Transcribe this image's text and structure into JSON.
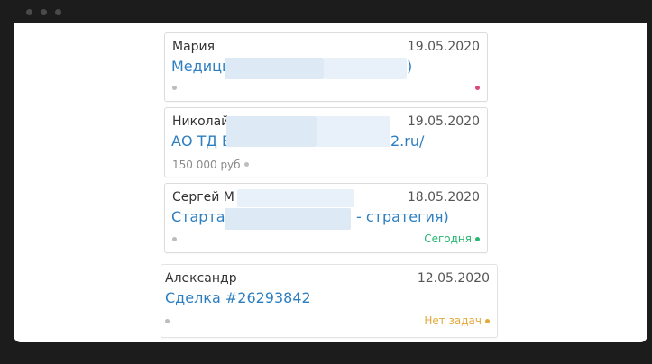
{
  "cards": [
    {
      "name": "Мария",
      "date": "19.05.2020",
      "title_prefix": "Медици",
      "title_suffix": ")",
      "amount": "",
      "status": "",
      "status_color": "#e0457b"
    },
    {
      "name": "Николай",
      "date": "19.05.2020",
      "title_prefix": "АО ТД В",
      "title_suffix": "2.ru/",
      "amount": "150 000 руб",
      "status": "",
      "status_color": ""
    },
    {
      "name": "Сергей М",
      "date": "18.05.2020",
      "title_prefix": "Стартап",
      "title_suffix": "- стратегия)",
      "amount": "",
      "status": "Сегодня",
      "status_color": "#2bb673"
    },
    {
      "name": "Александр",
      "date": "12.05.2020",
      "title_prefix": "Сделка #26293842",
      "title_suffix": "",
      "amount": "",
      "status": "Нет задач",
      "status_color": "#e3a83b"
    }
  ],
  "colors": {
    "link": "#2d7fc1",
    "muted_dot": "#bdbdbd"
  }
}
